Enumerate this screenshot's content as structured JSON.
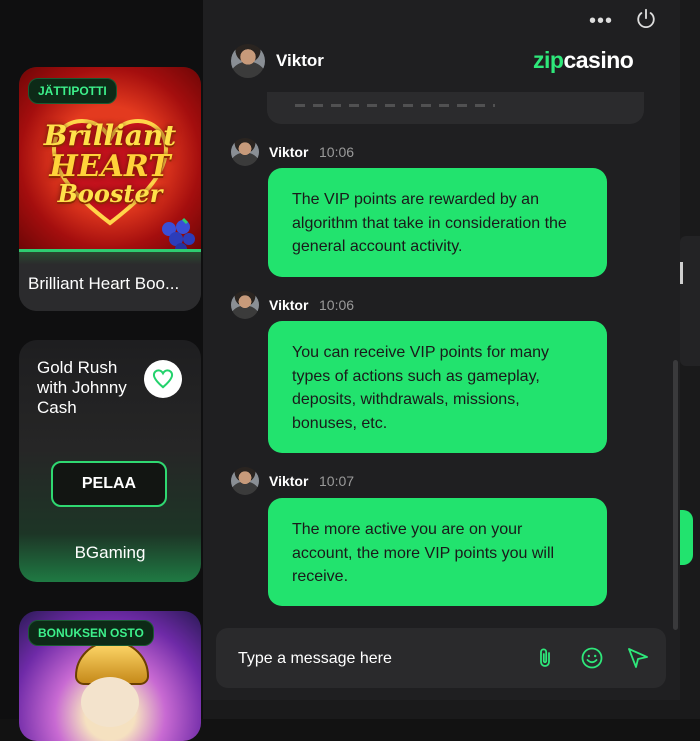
{
  "games": [
    {
      "badge": "JÄTTIPOTTI",
      "art_lines": [
        "Brilliant",
        "HEART",
        "Booster"
      ],
      "name": "Brilliant Heart Boo..."
    },
    {
      "title": "Gold Rush with Johnny Cash",
      "play_label": "PELAA",
      "provider": "BGaming"
    },
    {
      "badge": "BONUKSEN OSTO"
    }
  ],
  "chat": {
    "agent_name": "Viktor",
    "logo": {
      "zip": "zip",
      "casino": "casino"
    },
    "messages": [
      {
        "author": "Viktor",
        "time": "10:06",
        "text": "The VIP points are rewarded by an algorithm that take in consideration the general account activity."
      },
      {
        "author": "Viktor",
        "time": "10:06",
        "text": "You can receive VIP points for many types of actions such as gameplay, deposits, withdrawals, missions, bonuses, etc."
      },
      {
        "author": "Viktor",
        "time": "10:07",
        "text": "The more active you are on your account, the more VIP points you will receive."
      }
    ],
    "composer": {
      "placeholder": "Type a message here"
    },
    "icons": [
      "more-options-icon",
      "power-icon",
      "attachment-icon",
      "emoji-icon",
      "send-icon"
    ]
  },
  "colors": {
    "accent": "#22e36e",
    "background": "#121212",
    "panel": "#1f1f21"
  }
}
